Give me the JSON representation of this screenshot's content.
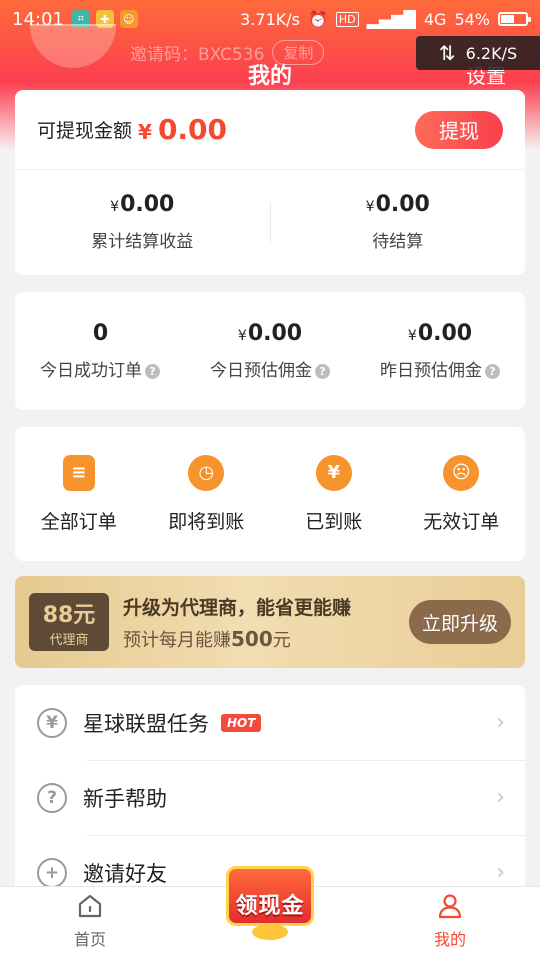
{
  "status_bar": {
    "time": "14:01",
    "net_speed": "3.71K/s",
    "network": "4G",
    "battery": "54%",
    "battery_level": 0.54
  },
  "speed_overlay": {
    "value": "6.2K/S"
  },
  "header": {
    "invite_code": "邀请码：BXC536",
    "copy_label": "复制",
    "title": "我的",
    "settings_label": "设置"
  },
  "balance": {
    "label": "可提现金额",
    "currency": "¥",
    "amount": "0.00",
    "withdraw_label": "提现",
    "cumulative_value": "0.00",
    "cumulative_label": "累计结算收益",
    "pending_value": "0.00",
    "pending_label": "待结算"
  },
  "stats": [
    {
      "value": "0",
      "currency": "",
      "label": "今日成功订单"
    },
    {
      "value": "0.00",
      "currency": "¥",
      "label": "今日预估佣金"
    },
    {
      "value": "0.00",
      "currency": "¥",
      "label": "昨日预估佣金"
    }
  ],
  "orders": [
    {
      "label": "全部订单",
      "icon": "clipboard-icon",
      "glyph": "≡"
    },
    {
      "label": "即将到账",
      "icon": "clock-icon",
      "glyph": "◷"
    },
    {
      "label": "已到账",
      "icon": "money-bag-icon",
      "glyph": "¥"
    },
    {
      "label": "无效订单",
      "icon": "sad-face-icon",
      "glyph": "☹"
    }
  ],
  "upgrade": {
    "badge_amount": "88元",
    "badge_label": "代理商",
    "title": "升级为代理商，能省更能赚",
    "subtitle_prefix": "预计每月能赚",
    "subtitle_amount": "500",
    "subtitle_suffix": "元",
    "button_label": "立即升级"
  },
  "menu": [
    {
      "label": "星球联盟任务",
      "icon": "yen-circle-icon",
      "glyph": "¥",
      "badge": "HOT"
    },
    {
      "label": "新手帮助",
      "icon": "help-circle-icon",
      "glyph": "?",
      "badge": ""
    },
    {
      "label": "邀请好友",
      "icon": "add-user-icon",
      "glyph": "+",
      "badge": ""
    }
  ],
  "bottom_nav": {
    "home_label": "首页",
    "promo_label": "领现金",
    "mine_label": "我的"
  },
  "colors": {
    "accent": "#f5482f",
    "header_top": "#fe6a3a",
    "order_icon": "#f7932c",
    "upgrade_button": "#8a6a4b"
  }
}
